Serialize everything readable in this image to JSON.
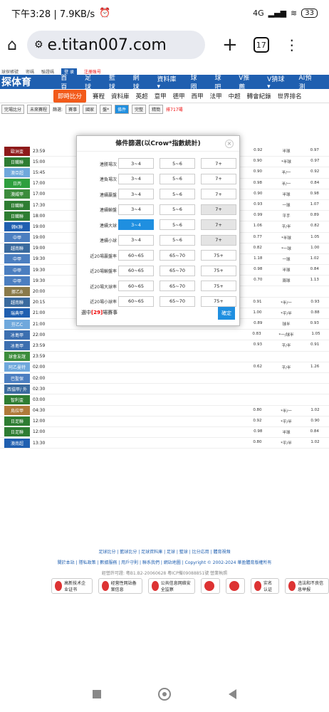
{
  "status": {
    "time": "下午3:28 | 7.9KB/s",
    "net": "4G",
    "battery": "33"
  },
  "browser": {
    "url": "e.titan007.com",
    "tabs": "17"
  },
  "site": {
    "logo": "探体育",
    "nav": [
      "首頁",
      "足球",
      "籃球",
      "網球",
      "資料庫▾",
      "球圈",
      "球吧",
      "V推薦",
      "V猜球▾",
      "AI預測"
    ],
    "subnav_hot": "即時比分",
    "subnav": [
      "賽程",
      "資料庫",
      "英超",
      "意甲",
      "德甲",
      "西甲",
      "法甲",
      "中超",
      "轉會紀錄",
      "世界排名"
    ],
    "tools": [
      "完場比分",
      "未來賽程",
      "篩選:",
      "賽事",
      "國家",
      "盤*",
      "條件",
      "完整",
      "精簡",
      "排717場"
    ],
    "rows": [
      {
        "league": "歐洲盃",
        "color": "#8e1a1a",
        "time": "23:59",
        "o": [
          "0.92",
          "半球",
          "0.97"
        ]
      },
      {
        "league": "日職聯",
        "color": "#2e7d32",
        "time": "15:00",
        "o": [
          "0.90",
          "*半球",
          "0.97"
        ]
      },
      {
        "league": "澳亞超",
        "color": "#6fa8dc",
        "time": "15:45",
        "o": [
          "0.90",
          "半/一",
          "0.92"
        ]
      },
      {
        "league": "日丙",
        "color": "#2e9f3e",
        "time": "17:00",
        "o": [
          "0.98",
          "半/一",
          "0.84"
        ]
      },
      {
        "league": "澳威甲",
        "color": "#3c8c3c",
        "time": "17:00",
        "o": [
          "0.90",
          "半球",
          "0.98"
        ]
      },
      {
        "league": "日職聯",
        "color": "#2e7d32",
        "time": "17:30",
        "o": [
          "0.93",
          "一球",
          "1.07"
        ]
      },
      {
        "league": "日職聯",
        "color": "#2e7d32",
        "time": "18:00",
        "o": [
          "0.99",
          "平手",
          "0.89"
        ]
      },
      {
        "league": "韓K聯",
        "color": "#1f5fb0",
        "time": "19:00",
        "o": [
          "1.06",
          "平/半",
          "0.82"
        ]
      },
      {
        "league": "中甲",
        "color": "#4b7ec0",
        "time": "19:00",
        "o": [
          "0.77",
          "*半球",
          "1.05"
        ]
      },
      {
        "league": "越南聯",
        "color": "#3a6a9e",
        "time": "19:00",
        "o": [
          "0.82",
          "*一球",
          "1.00"
        ]
      },
      {
        "league": "中甲",
        "color": "#4b7ec0",
        "time": "19:30",
        "o": [
          "1.18",
          "一球",
          "1.02"
        ]
      },
      {
        "league": "中甲",
        "color": "#4b7ec0",
        "time": "19:30",
        "o": [
          "0.98",
          "半球",
          "0.84"
        ]
      },
      {
        "league": "中甲",
        "color": "#4b7ec0",
        "time": "19:30",
        "o": [
          "0.70",
          "兩球",
          "1.13"
        ]
      },
      {
        "league": "挪乙B",
        "color": "#8a7a4a",
        "time": "20:00",
        "o": [
          "",
          "",
          ""
        ]
      },
      {
        "league": "越南聯",
        "color": "#3a6a9e",
        "time": "20:15",
        "o": [
          "0.91",
          "*半/一",
          "0.93"
        ]
      },
      {
        "league": "瑞典甲",
        "color": "#1f5fb0",
        "time": "21:00",
        "o": [
          "1.00",
          "*平/半",
          "0.88"
        ]
      },
      {
        "league": "芬乙C",
        "color": "#6fa8dc",
        "time": "21:00",
        "o": [
          "0.89",
          "球半",
          "0.93"
        ]
      },
      {
        "league": "冰島甲",
        "color": "#3c6fb0",
        "time": "22:00",
        "o": [
          "0.83",
          "*一/球半",
          "1.05"
        ]
      },
      {
        "league": "冰島甲",
        "color": "#3c6fb0",
        "time": "23:59",
        "o": [
          "0.93",
          "平/半",
          "0.91"
        ]
      },
      {
        "league": "球會友誼",
        "color": "#3c8c3c",
        "time": "23:59",
        "o": [
          "",
          "",
          ""
        ]
      },
      {
        "league": "阿乙曼特",
        "color": "#6fa8dc",
        "time": "02:00",
        "o": [
          "0.62",
          "平/半",
          "1.26"
        ]
      },
      {
        "league": "巴聖保",
        "color": "#4b7ec0",
        "time": "02:00",
        "o": [
          "",
          "",
          ""
        ]
      },
      {
        "league": "西協甲/ 外",
        "color": "#3a6a9e",
        "time": "02:30",
        "o": [
          "",
          "",
          ""
        ]
      },
      {
        "league": "智利盃",
        "color": "#2e7d32",
        "time": "03:00",
        "o": [
          "",
          "",
          ""
        ]
      },
      {
        "league": "烏拉甲",
        "color": "#b07a3a",
        "time": "04:30",
        "o": [
          "0.80",
          "*半/一",
          "1.02"
        ]
      },
      {
        "league": "日足聯",
        "color": "#2e7d32",
        "time": "12:00",
        "o": [
          "0.92",
          "*平/半",
          "0.90"
        ]
      },
      {
        "league": "日足聯",
        "color": "#2e7d32",
        "time": "12:00",
        "o": [
          "0.98",
          "半球",
          "0.84"
        ]
      },
      {
        "league": "澳南超",
        "color": "#1f5fb0",
        "time": "13:30",
        "o": [
          "0.80",
          "*平/半",
          "1.02"
        ]
      }
    ]
  },
  "modal": {
    "title": "條件篩選(以Crow*指數統計)",
    "close": "×",
    "rows": [
      {
        "label": "連勝場次",
        "opts": [
          "3~4",
          "5~6",
          "7+"
        ]
      },
      {
        "label": "連負場次",
        "opts": [
          "3~4",
          "5~6",
          "7+"
        ]
      },
      {
        "label": "連續贏盤",
        "opts": [
          "3~4",
          "5~6",
          "7+"
        ]
      },
      {
        "label": "連續輸盤",
        "opts": [
          "3~4",
          "5~6",
          "7+"
        ]
      },
      {
        "label": "連續大球",
        "opts": [
          "3~4",
          "5~6",
          "7+"
        ]
      },
      {
        "label": "連續小球",
        "opts": [
          "3~4",
          "5~6",
          "7+"
        ]
      },
      {
        "label": "近20場贏盤率",
        "opts": [
          "60~65",
          "65~70",
          "75+"
        ]
      },
      {
        "label": "近20場輸盤率",
        "opts": [
          "60~65",
          "65~70",
          "75+"
        ]
      },
      {
        "label": "近20場大球率",
        "opts": [
          "60~65",
          "65~70",
          "75+"
        ]
      },
      {
        "label": "近20場小球率",
        "opts": [
          "60~65",
          "65~70",
          "75+"
        ]
      }
    ],
    "selected_prefix": "選中",
    "selected_count": "[29]",
    "selected_suffix": "場賽事",
    "confirm": "確定"
  },
  "footer": {
    "line1": "足球比分 | 籃球比分 | 足球資料庫 | 足球 | 籃球 | 比分応用 | 體育視頻",
    "line2": "關於本站 | 隱私政策 | 數據服務 | 用戶守則 | 聯系我們 | 網站地圖 | Copyright © 2002-2024 華盈體育版權所有",
    "line3": "經營許可證: 粵B1.B2-20060628 粵ICP備09088851號 營業執照"
  },
  "badges": [
    "高新技术企业证书",
    "经营性网站备案信息",
    "公共信息网络安全监察",
    "",
    "",
    "实名认证",
    "违法和不良信息举报"
  ]
}
